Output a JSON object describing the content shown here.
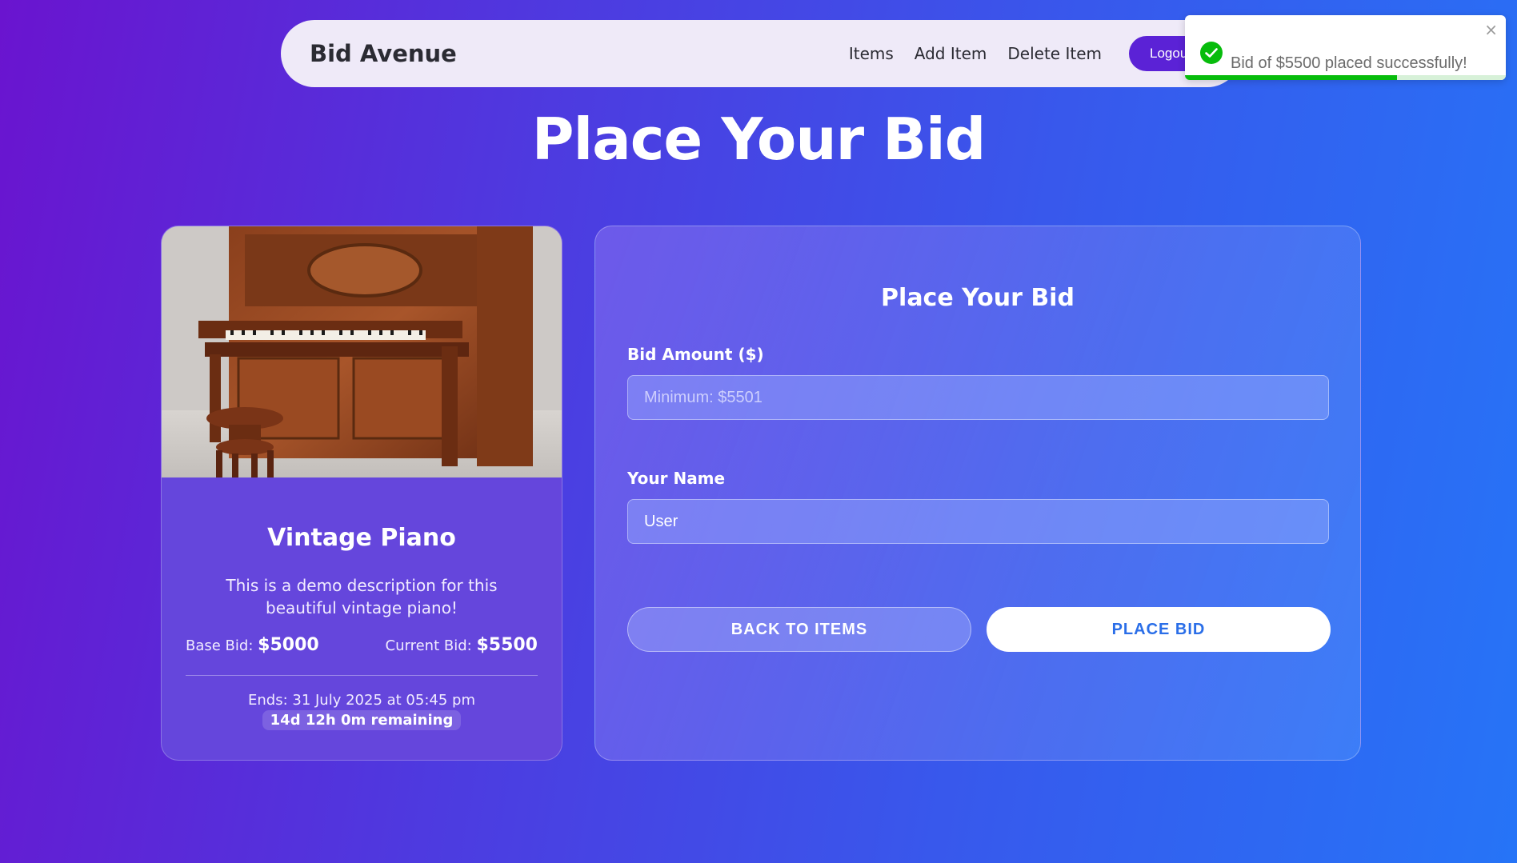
{
  "navbar": {
    "brand": "Bid Avenue",
    "links": [
      "Items",
      "Add Item",
      "Delete Item"
    ],
    "logout_label": "Logout"
  },
  "toast": {
    "message": "Bid of $5500 placed successfully!",
    "close_symbol": "×",
    "progress": 0.66
  },
  "page_title": "Place Your Bid",
  "item": {
    "title": "Vintage Piano",
    "description": "This is a demo description for this beautiful vintage piano!",
    "base_bid_label": "Base Bid:",
    "base_bid_value": "$5000",
    "current_bid_label": "Current Bid:",
    "current_bid_value": "$5500",
    "ends": "Ends: 31 July 2025 at 05:45 pm",
    "remaining": "14d 12h 0m remaining"
  },
  "bid_form": {
    "title": "Place Your Bid",
    "amount_label": "Bid Amount ($)",
    "amount_placeholder": "Minimum: $5501",
    "amount_value": "",
    "name_label": "Your Name",
    "name_value": "User",
    "back_label": "BACK TO ITEMS",
    "place_label": "PLACE BID"
  },
  "colors": {
    "accent": "#5b22d6",
    "success": "#07bc0c",
    "place_bid_text": "#2a6ee8"
  }
}
